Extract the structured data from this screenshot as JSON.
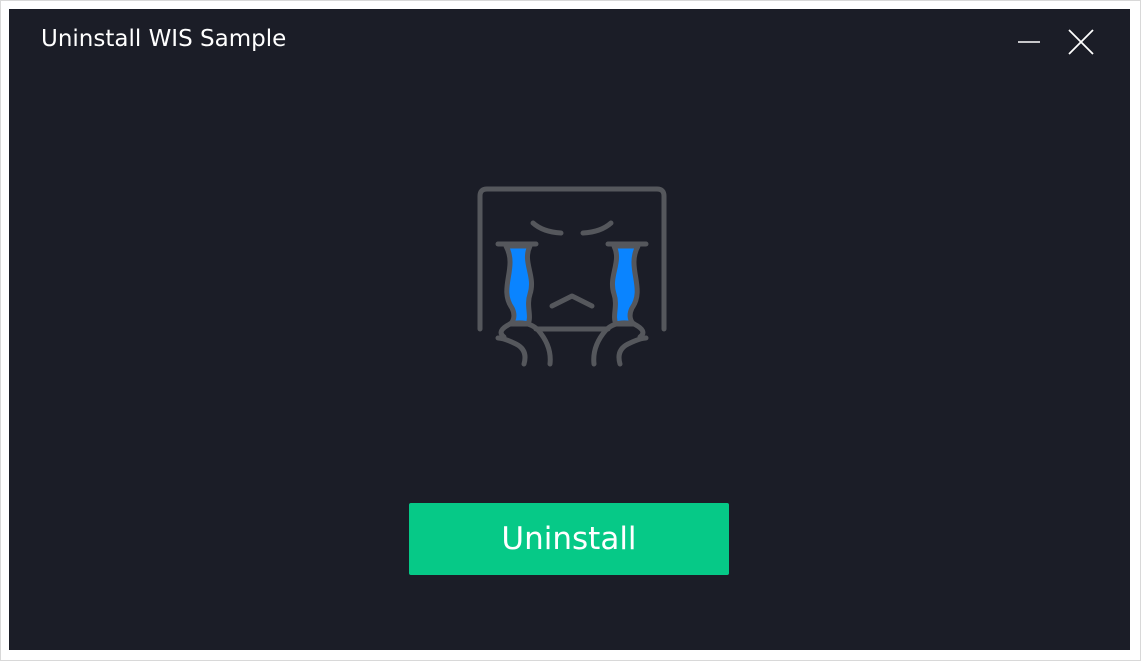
{
  "window": {
    "title": "Uninstall WIS Sample"
  },
  "controls": {
    "minimize_icon": "minimize-icon",
    "close_icon": "close-icon"
  },
  "illustration": {
    "icon": "crying-face-icon",
    "tear_color": "#0a84ff",
    "line_color": "#55575c"
  },
  "actions": {
    "uninstall_label": "Uninstall",
    "uninstall_color": "#06c987"
  },
  "colors": {
    "background": "#1b1d27",
    "text": "#ffffff"
  }
}
